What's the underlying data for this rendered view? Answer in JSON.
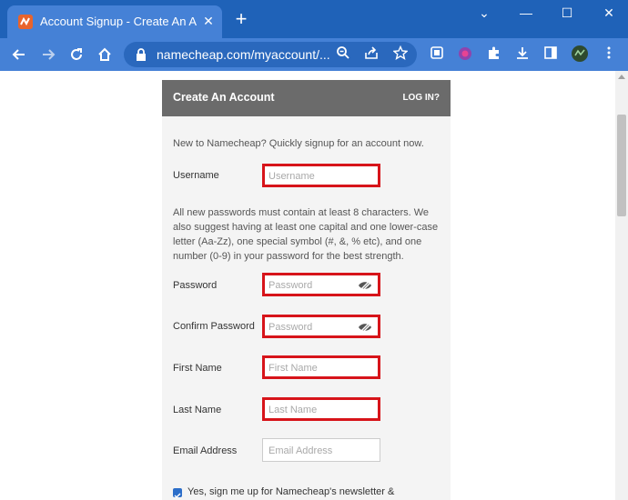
{
  "browser": {
    "tab_title": "Account Signup - Create An Acc",
    "url": "namecheap.com/myaccount/...",
    "new_tab": "+",
    "close_tab": "✕",
    "minimize": "⌄",
    "restore": "—",
    "maximize": "☐",
    "close_window": "✕"
  },
  "form": {
    "title": "Create An Account",
    "login_link": "LOG IN?",
    "intro": "New to Namecheap? Quickly signup for an account now.",
    "password_note": "All new passwords must contain at least 8 characters. We also suggest having at least one capital and one lower-case letter (Aa-Zz), one special symbol (#, &, % etc), and one number (0-9) in your password for the best strength.",
    "username": {
      "label": "Username",
      "placeholder": "Username"
    },
    "password": {
      "label": "Password",
      "placeholder": "Password"
    },
    "confirm_password": {
      "label": "Confirm Password",
      "placeholder": "Password"
    },
    "first_name": {
      "label": "First Name",
      "placeholder": "First Name"
    },
    "last_name": {
      "label": "Last Name",
      "placeholder": "Last Name"
    },
    "email": {
      "label": "Email Address",
      "placeholder": "Email Address"
    },
    "newsletter": "Yes, sign me up for Namecheap's newsletter &"
  },
  "colors": {
    "titlebar": "#1f62b8",
    "toolbar": "#4581d6",
    "card_header": "#6b6b6b",
    "highlight": "#d7141a"
  }
}
